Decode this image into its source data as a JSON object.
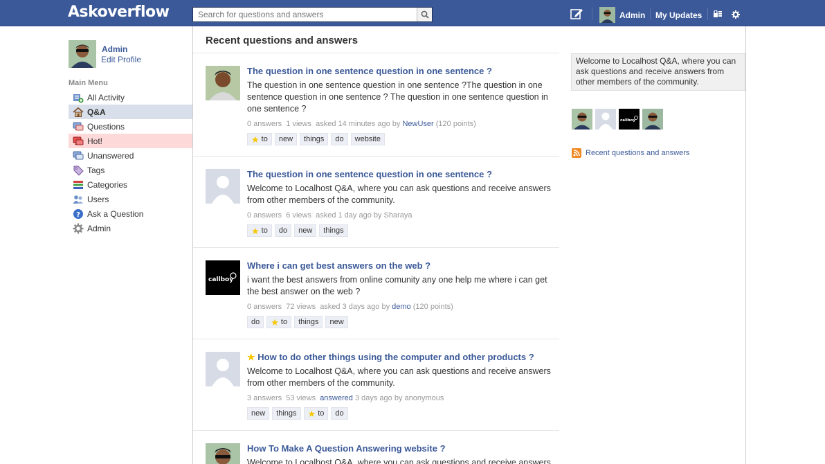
{
  "header": {
    "logo": "Askoverflow",
    "search_placeholder": "Search for questions and answers",
    "user_name": "Admin",
    "updates_label": "My Updates",
    "icons": [
      "search-icon",
      "edit-icon",
      "lock-icon",
      "gear-icon"
    ]
  },
  "sidebar": {
    "user_name": "Admin",
    "edit_profile": "Edit Profile",
    "menu_title": "Main Menu",
    "items": [
      {
        "label": "All Activity",
        "icon": "activity-icon"
      },
      {
        "label": "Q&A",
        "icon": "home-icon"
      },
      {
        "label": "Questions",
        "icon": "questions-icon"
      },
      {
        "label": "Hot!",
        "icon": "hot-icon"
      },
      {
        "label": "Unanswered",
        "icon": "unanswered-icon"
      },
      {
        "label": "Tags",
        "icon": "tag-icon"
      },
      {
        "label": "Categories",
        "icon": "categories-icon"
      },
      {
        "label": "Users",
        "icon": "users-icon"
      },
      {
        "label": "Ask a Question",
        "icon": "help-icon"
      },
      {
        "label": "Admin",
        "icon": "admin-gear-icon"
      }
    ]
  },
  "main": {
    "title": "Recent questions and answers",
    "questions": [
      {
        "title": "The question in one sentence question in one sentence ?",
        "text": "The question in one sentence question in one sentence ?The question in one sentence question in one sentence ? The question in one sentence question in one sentence ?",
        "answers": "0 answers",
        "views": "1 views",
        "asked": "asked 14 minutes ago by",
        "user": "NewUser",
        "points": "(120 points)",
        "tags": [
          "to",
          "new",
          "things",
          "do",
          "website"
        ]
      },
      {
        "title": "The question in one sentence question in one sentence ?",
        "text": "Welcome to Localhost Q&A, where you can ask questions and receive answers from other members of the community.",
        "answers": "0 answers",
        "views": "6 views",
        "asked": "asked 1 day ago by Sharaya",
        "tags": [
          "to",
          "do",
          "new",
          "things"
        ]
      },
      {
        "title": "Where i can get best answers on the web ?",
        "text": "i want the best answers from online comunity any one help me where i can get the best answer on the web ?",
        "answers": "0 answers",
        "views": "72 views",
        "asked": "asked 3 days ago by",
        "user": "demo",
        "points": "(120 points)",
        "tags": [
          "do",
          "to",
          "things",
          "new"
        ]
      },
      {
        "title": "How to do other things using the computer and other products ?",
        "text": "Welcome to Localhost Q&A, where you can ask questions and receive answers from other members of the community.",
        "answers": "3 answers",
        "views": "53 views",
        "answered": "answered",
        "asked": "3 days ago by anonymous",
        "tags": [
          "new",
          "things",
          "to",
          "do"
        ]
      },
      {
        "title": "How To Make A Question Answering website ?",
        "text": "Welcome to Localhost Q&A, where you can ask questions and receive answers"
      }
    ]
  },
  "right": {
    "welcome": "Welcome to Localhost Q&A, where you can ask questions and receive answers from other members of the community.",
    "logo_text": "callboy",
    "rss_label": "Recent questions and answers"
  },
  "colors": {
    "brand": "#3b5998",
    "active_menu": "#d8dfea",
    "hot_menu": "#fdd9d9",
    "star": "#f6c600"
  }
}
